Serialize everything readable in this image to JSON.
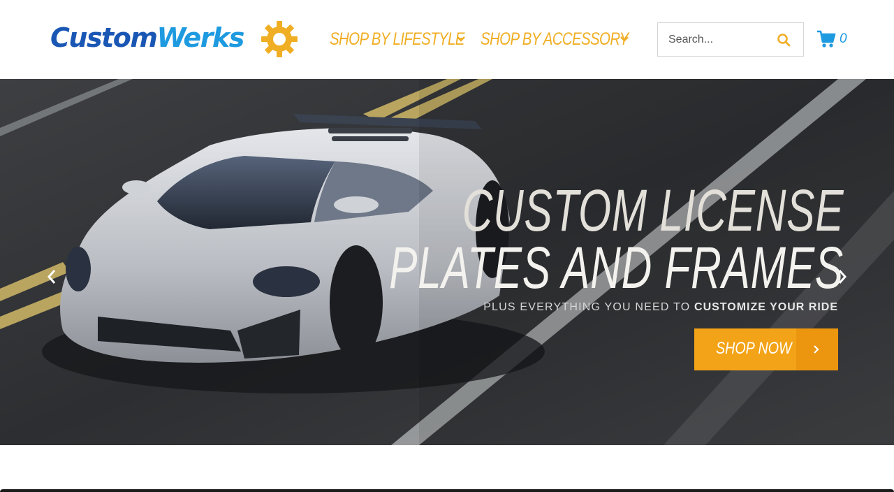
{
  "brand": {
    "logo_part1": "Custom",
    "logo_part2": "Werks",
    "primary_color": "#1a57b4",
    "secondary_color": "#1d9ae0",
    "accent_color": "#f0ae24"
  },
  "nav": {
    "items": [
      {
        "label": "SHOP BY LIFESTYLE",
        "icon": "chevron-down-icon"
      },
      {
        "label": "SHOP BY ACCESSORY",
        "icon": "chevron-down-icon"
      }
    ]
  },
  "search": {
    "placeholder": "Search...",
    "icon": "search-icon"
  },
  "cart": {
    "icon": "cart-icon",
    "count": "0"
  },
  "hero": {
    "headline_line1": "CUSTOM LICENSE",
    "headline_line2": "PLATES AND FRAMES",
    "subline_prefix": "PLUS EVERYTHING YOU NEED TO ",
    "subline_emphasis": "CUSTOMIZE YOUR RIDE",
    "cta_label": "SHOP NOW",
    "cta_icon": "chevron-right-icon",
    "prev_icon": "chevron-left-icon",
    "next_icon": "chevron-right-icon",
    "button_color": "#f3a317"
  }
}
